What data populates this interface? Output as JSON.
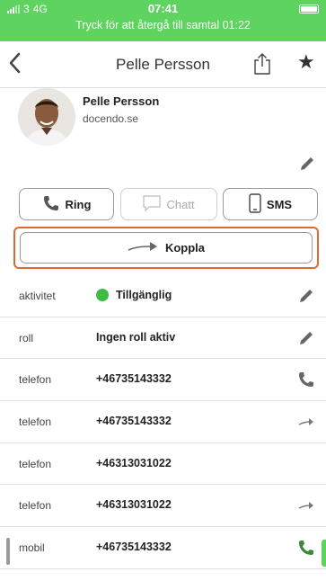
{
  "status_bar": {
    "carrier": "3",
    "network": "4G",
    "time": "07:41",
    "call_banner": "Tryck för att återgå till samtal 01:22",
    "color": "#5fd35f"
  },
  "navbar": {
    "back_icon": "chevron-left-icon",
    "title": "Pelle Persson",
    "share_icon": "share-icon",
    "favorite_icon": "star-icon"
  },
  "contact": {
    "name": "Pelle Persson",
    "organization": "docendo.se"
  },
  "actions": {
    "ring_label": "Ring",
    "chatt_label": "Chatt",
    "sms_label": "SMS",
    "koppla_label": "Koppla",
    "highlight_color": "#e06a2c"
  },
  "details": [
    {
      "label": "aktivitet",
      "value": "Tillgänglig",
      "action": "pencil-icon",
      "status_color": "#3dbb45"
    },
    {
      "label": "roll",
      "value": "Ingen roll aktiv",
      "action": "pencil-icon"
    },
    {
      "label": "telefon",
      "value": "+46735143332",
      "action": "phone-icon"
    },
    {
      "label": "telefon",
      "value": "+46735143332",
      "action": "transfer-arrow-icon"
    },
    {
      "label": "telefon",
      "value": "+46313031022",
      "action": ""
    },
    {
      "label": "telefon",
      "value": "+46313031022",
      "action": "transfer-arrow-icon"
    },
    {
      "label": "mobil",
      "value": "+46735143332",
      "action": "phone-icon"
    }
  ]
}
